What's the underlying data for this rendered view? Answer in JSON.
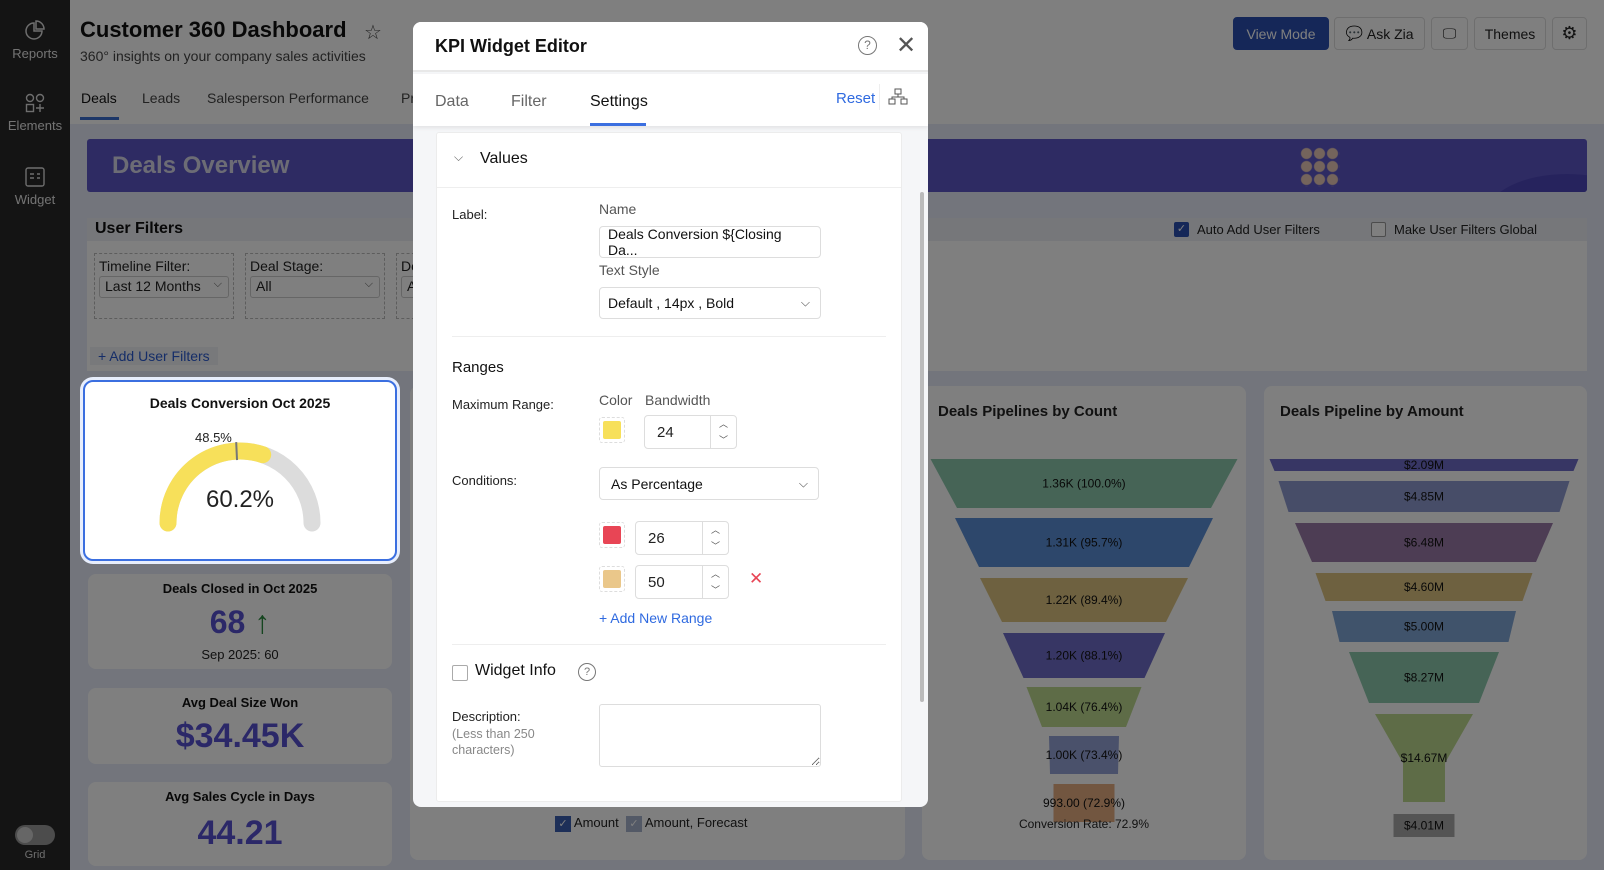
{
  "sidebar": {
    "items": [
      {
        "label": "Reports"
      },
      {
        "label": "Elements"
      },
      {
        "label": "Widget"
      }
    ],
    "grid_label": "Grid"
  },
  "header": {
    "title": "Customer 360 Dashboard",
    "subtitle": "360° insights on your company sales activities",
    "tabs": [
      {
        "label": "Deals"
      },
      {
        "label": "Leads"
      },
      {
        "label": "Salesperson Performance"
      },
      {
        "label": "Pr"
      }
    ],
    "buttons": {
      "view_mode": "View Mode",
      "ask_zia": "Ask Zia",
      "themes": "Themes"
    }
  },
  "banner": {
    "title": "Deals Overview"
  },
  "user_filters": {
    "title": "User Filters",
    "auto_add": "Auto Add User Filters",
    "make_global": "Make User Filters Global",
    "add": "+ Add User Filters",
    "filters": [
      {
        "label": "Timeline Filter:",
        "value": "Last 12 Months"
      },
      {
        "label": "Deal Stage:",
        "value": "All"
      },
      {
        "label": "De",
        "value": "A"
      }
    ]
  },
  "kpis": {
    "conversion": {
      "title": "Deals Conversion Oct 2025",
      "value": "60.2%",
      "target_label": "48.5%",
      "value_pct": 60.2,
      "target_pct": 48.5
    },
    "closed": {
      "title": "Deals Closed in Oct 2025",
      "value": "68",
      "compare": "Sep 2025: 60"
    },
    "deal_size": {
      "title": "Avg Deal Size Won",
      "value": "$34.45K"
    },
    "cycle": {
      "title": "Avg Sales Cycle in Days",
      "value": "44.21"
    }
  },
  "middle_chart": {
    "legend": [
      "Amount",
      "Amount, Forecast"
    ]
  },
  "chart_data": [
    {
      "type": "funnel",
      "title": "Deals Pipelines by Count",
      "labels": [
        "1.36K (100.0%)",
        "1.31K (95.7%)",
        "1.22K (89.4%)",
        "1.20K (88.1%)",
        "1.04K (76.4%)",
        "1.00K (73.4%)",
        "993.00 (72.9%)"
      ],
      "values": [
        1360,
        1310,
        1220,
        1200,
        1040,
        1000,
        993
      ],
      "colors": [
        "#8cc9ad",
        "#5a8ed6",
        "#dcc381",
        "#6e6cc8",
        "#bcd98f",
        "#95a3d6",
        "#e4ad80"
      ],
      "footer": "Conversion Rate: 72.9%"
    },
    {
      "type": "funnel",
      "title": "Deals Pipeline by Amount",
      "labels": [
        "$2.09M",
        "$4.85M",
        "$6.48M",
        "$4.60M",
        "$5.00M",
        "$8.27M",
        "$14.67M",
        "$4.01M"
      ],
      "values": [
        2.09,
        4.85,
        6.48,
        4.6,
        5.0,
        8.27,
        14.67,
        4.01
      ],
      "colors": [
        "#6e6cc8",
        "#8f9bd0",
        "#9a7aa8",
        "#dcc381",
        "#80a6d6",
        "#8cc9ad",
        "#bcd98f",
        "#a8a8a8"
      ]
    }
  ],
  "modal": {
    "title": "KPI Widget Editor",
    "tabs": [
      {
        "label": "Data"
      },
      {
        "label": "Filter"
      },
      {
        "label": "Settings"
      }
    ],
    "active_tab": "Settings",
    "reset": "Reset",
    "values_section": "Values",
    "label_label": "Label:",
    "name_label": "Name",
    "name_value": "Deals Conversion ${Closing Da...",
    "text_style_label": "Text Style",
    "text_style_value": "Default , 14px , Bold",
    "ranges": "Ranges",
    "max_range_label": "Maximum Range:",
    "color_label": "Color",
    "bandwidth_label": "Bandwidth",
    "bandwidth_value": "24",
    "max_color": "#f7e05a",
    "conditions_label": "Conditions:",
    "conditions_value": "As Percentage",
    "condition_rows": [
      {
        "color": "#e84555",
        "value": "26"
      },
      {
        "color": "#eac78a",
        "value": "50"
      }
    ],
    "add_range": "+ Add New Range",
    "widget_info": "Widget Info",
    "description_label": "Description:",
    "description_hint": "(Less than 250 characters)",
    "description_value": ""
  }
}
